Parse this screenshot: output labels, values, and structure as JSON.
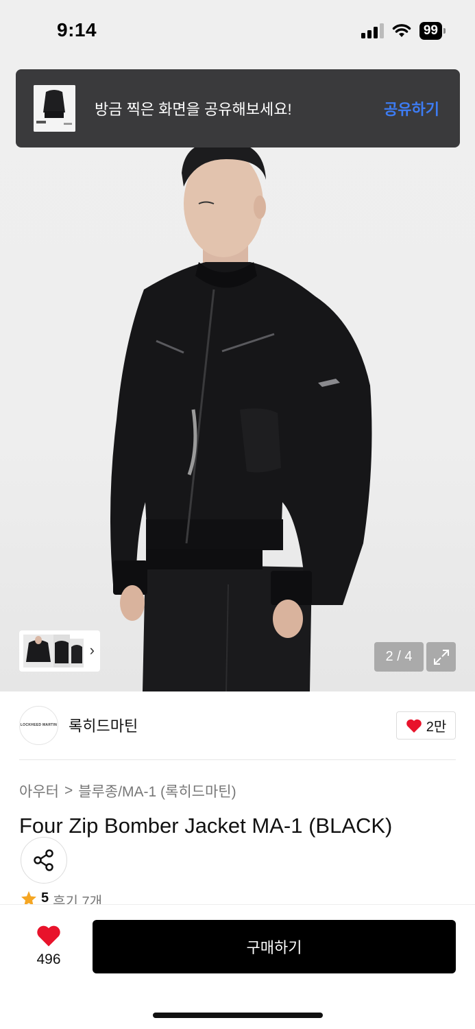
{
  "status_bar": {
    "time": "9:14",
    "battery": "99"
  },
  "toast": {
    "message": "방금 찍은 화면을 공유해보세요!",
    "action": "공유하기"
  },
  "gallery": {
    "page_indicator": "2 / 4",
    "thumbnail_count": 3
  },
  "brand": {
    "logo_text": "LOCKHEED MARTIN",
    "name": "록히드마틴",
    "like_count": "2만"
  },
  "breadcrumb": {
    "category": "아우터",
    "separator": ">",
    "subcategory": "블루종/MA-1 (록히드마틴)"
  },
  "product": {
    "title": "Four Zip Bomber Jacket MA-1 (BLACK)",
    "rating": "5",
    "reviews": "후기 7개"
  },
  "bottom_bar": {
    "like_count": "496",
    "buy_label": "구매하기"
  },
  "colors": {
    "accent_blue": "#3d7cf4",
    "heart_red": "#e8132b",
    "star_orange": "#f5a623",
    "toast_bg": "#3a3a3c"
  }
}
